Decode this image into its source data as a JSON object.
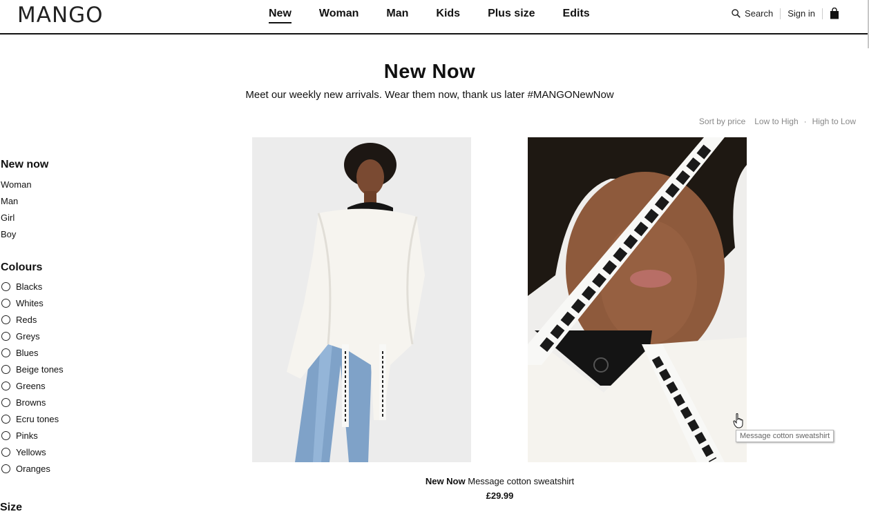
{
  "brand": {
    "logo": "MANGO"
  },
  "nav": {
    "items": [
      {
        "label": "New",
        "active": true
      },
      {
        "label": "Woman"
      },
      {
        "label": "Man"
      },
      {
        "label": "Kids"
      },
      {
        "label": "Plus size"
      },
      {
        "label": "Edits"
      }
    ]
  },
  "utility": {
    "search_label": "Search",
    "sign_in_label": "Sign in",
    "bag_icon": "shopping-bag-icon",
    "search_icon": "search-icon"
  },
  "hero": {
    "title": "New Now",
    "subtitle": "Meet our weekly new arrivals. Wear them now, thank us later #MANGONewNow"
  },
  "sort": {
    "label": "Sort by price",
    "low_high": "Low to High",
    "separator": "·",
    "high_low": "High to Low"
  },
  "sidebar": {
    "new_now": {
      "heading": "New now",
      "links": [
        "Woman",
        "Man",
        "Girl",
        "Boy"
      ]
    },
    "colours": {
      "heading": "Colours",
      "options": [
        "Blacks",
        "Whites",
        "Reds",
        "Greys",
        "Blues",
        "Beige tones",
        "Greens",
        "Browns",
        "Ecru tones",
        "Pinks",
        "Yellows",
        "Oranges"
      ]
    },
    "size": {
      "heading": "Size"
    }
  },
  "product": {
    "tag": "New Now",
    "name": "Message cotton sweatshirt",
    "price": "£29.99",
    "tooltip": "Message cotton sweatshirt"
  },
  "colors": {
    "text": "#111111",
    "muted": "#888888",
    "accent": "#111111"
  }
}
